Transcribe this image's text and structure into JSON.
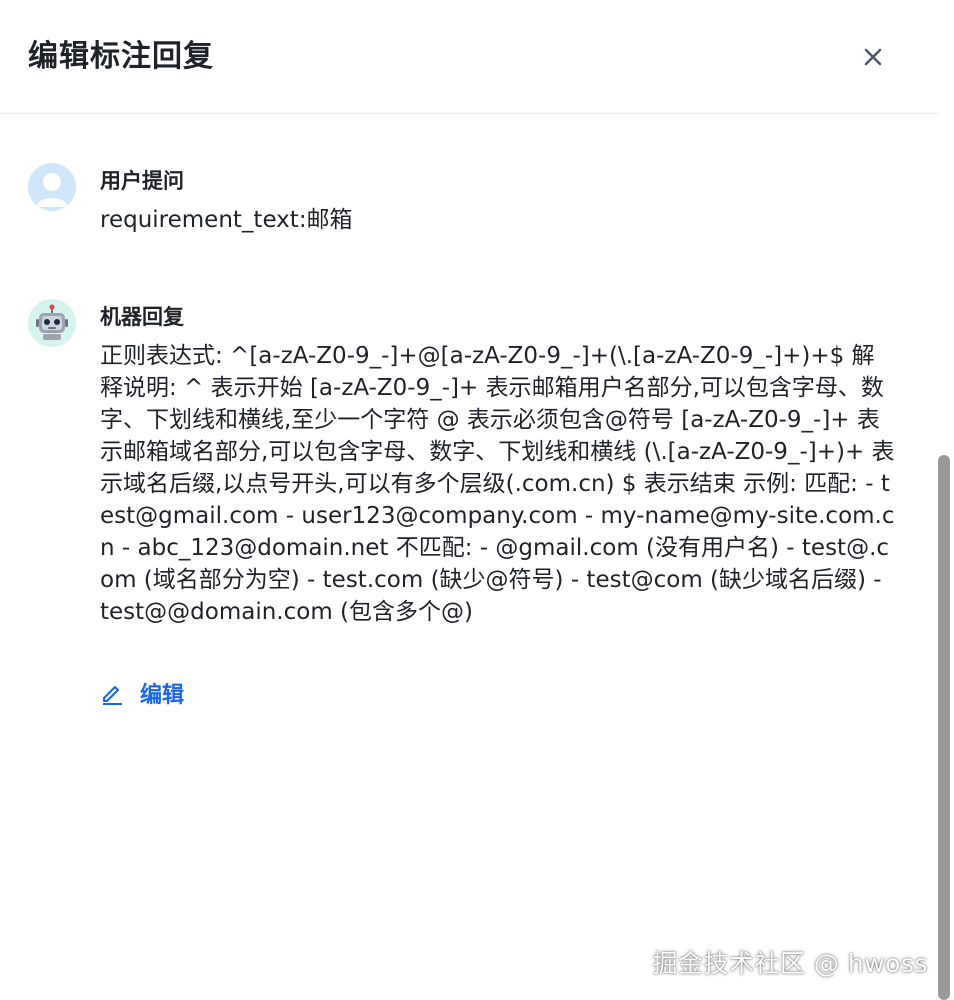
{
  "dialog": {
    "title": "编辑标注回复",
    "close_icon": "close-icon"
  },
  "messages": [
    {
      "role": "user",
      "avatar_icon": "user-avatar-icon",
      "name": "用户提问",
      "text": "requirement_text:邮箱"
    },
    {
      "role": "bot",
      "avatar_icon": "robot-avatar-icon",
      "name": "机器回复",
      "text": "正则表达式: ^[a-zA-Z0-9_-]+@[a-zA-Z0-9_-]+(\\.[a-zA-Z0-9_-]+)+$ 解释说明: ^ 表示开始 [a-zA-Z0-9_-]+ 表示邮箱用户名部分,可以包含字母、数字、下划线和横线,至少一个字符 @ 表示必须包含@符号 [a-zA-Z0-9_-]+ 表示邮箱域名部分,可以包含字母、数字、下划线和横线 (\\.[a-zA-Z0-9_-]+)+ 表示域名后缀,以点号开头,可以有多个层级(.com.cn) $ 表示结束 示例: 匹配: - test@gmail.com - user123@company.com - my-name@my-site.com.cn - abc_123@domain.net 不匹配: - @gmail.com (没有用户名) - test@.com (域名部分为空) - test.com (缺少@符号) - test@com (缺少域名后缀) - test@@domain.com (包含多个@)",
      "edit_label": "编辑",
      "edit_icon": "pencil-icon"
    }
  ],
  "watermark": "掘金技术社区 @ hwoss",
  "colors": {
    "accent": "#1a66e6",
    "text": "#1f2329",
    "user_avatar_bg": "#cfe6fb",
    "bot_avatar_bg": "#d5f3ef"
  }
}
